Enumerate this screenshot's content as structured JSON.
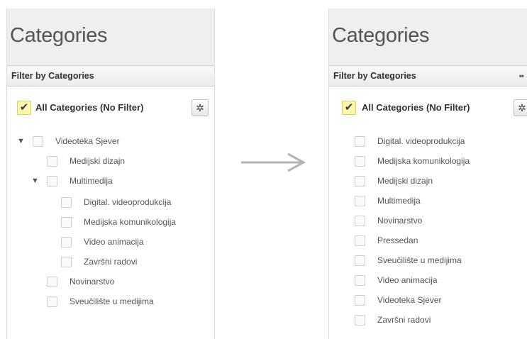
{
  "left_panel": {
    "title": "Categories",
    "filter_label": "Filter by Categories",
    "all_label": "All Categories (No Filter)",
    "items": [
      {
        "label": "Videoteka Sjever",
        "expanded": true
      },
      {
        "label": "Medijski dizajn"
      },
      {
        "label": "Multimedija",
        "expanded": true
      },
      {
        "label": "Digital. videoprodukcija"
      },
      {
        "label": "Medijska komunikologija"
      },
      {
        "label": "Video animacija"
      },
      {
        "label": "Završni radovi"
      },
      {
        "label": "Novinarstvo"
      },
      {
        "label": "Sveučilište u medijima"
      }
    ]
  },
  "right_panel": {
    "title": "Categories",
    "filter_label": "Filter by Categories",
    "more": "••",
    "all_label": "All Categories (No Filter)",
    "items": [
      {
        "label": "Digital. videoprodukcija"
      },
      {
        "label": "Medijska komunikologija"
      },
      {
        "label": "Medijski dizajn"
      },
      {
        "label": "Multimedija"
      },
      {
        "label": "Novinarstvo"
      },
      {
        "label": "Pressedan"
      },
      {
        "label": "Sveučilište u medijima"
      },
      {
        "label": "Video animacija"
      },
      {
        "label": "Videoteka Sjever"
      },
      {
        "label": "Završni radovi"
      }
    ]
  },
  "glyphs": {
    "check": "✔",
    "gear": "✲",
    "expanded": "▼"
  },
  "colors": {
    "header_bg": "#efefef",
    "check_bg": "#fff6a8",
    "arrow": "#b3b3b3"
  }
}
